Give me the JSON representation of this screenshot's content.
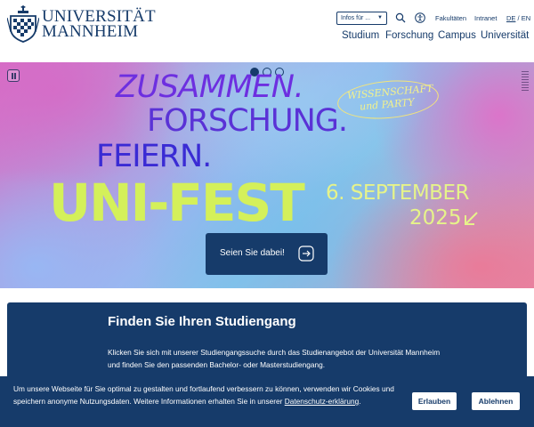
{
  "logo": {
    "line1": "UNIVERSITÄT",
    "line2": "MANNHEIM"
  },
  "header": {
    "infos_select": "Infos für ...",
    "top_links": [
      "Fakultäten",
      "Intranet"
    ],
    "lang_de": "DE",
    "lang_sep": " / ",
    "lang_en": "EN",
    "main_nav": [
      "Studium",
      "Forschung",
      "Campus",
      "Universität"
    ]
  },
  "hero": {
    "line1": "ZUSAMMEN.",
    "line2": "FORSCHUNG.",
    "line3": "FEIERN.",
    "event": "UNI-FEST",
    "oval_line1": "WISSENSCHAFT",
    "oval_line2": "und PARTY",
    "date_line1": "6. SEPTEMBER",
    "date_line2": "2025",
    "cta_label": "Seien Sie dabei!",
    "slides_total": 3,
    "slide_active": 1
  },
  "study": {
    "title": "Finden Sie Ihren Studiengang",
    "text": "Klicken Sie sich mit unserer Studiengangssuche durch das Studienangebot der Universität Mannheim und finden Sie den passenden Bachelor- oder Masterstudiengang."
  },
  "cookie": {
    "text": "Um unsere Webseite für Sie optimal zu gestalten und fortlaufend verbessern zu können, verwenden wir Cookies und speichern anonyme Nutzungsdaten. Weitere Informationen erhalten Sie in unserer ",
    "link": "Datenschutz-erklärung",
    "text_end": ".",
    "accept": "Erlauben",
    "reject": "Ablehnen"
  },
  "colors": {
    "brand": "#163b6a",
    "accent_lime": "#d4f05a",
    "headline_purple": "#5a32d6"
  }
}
